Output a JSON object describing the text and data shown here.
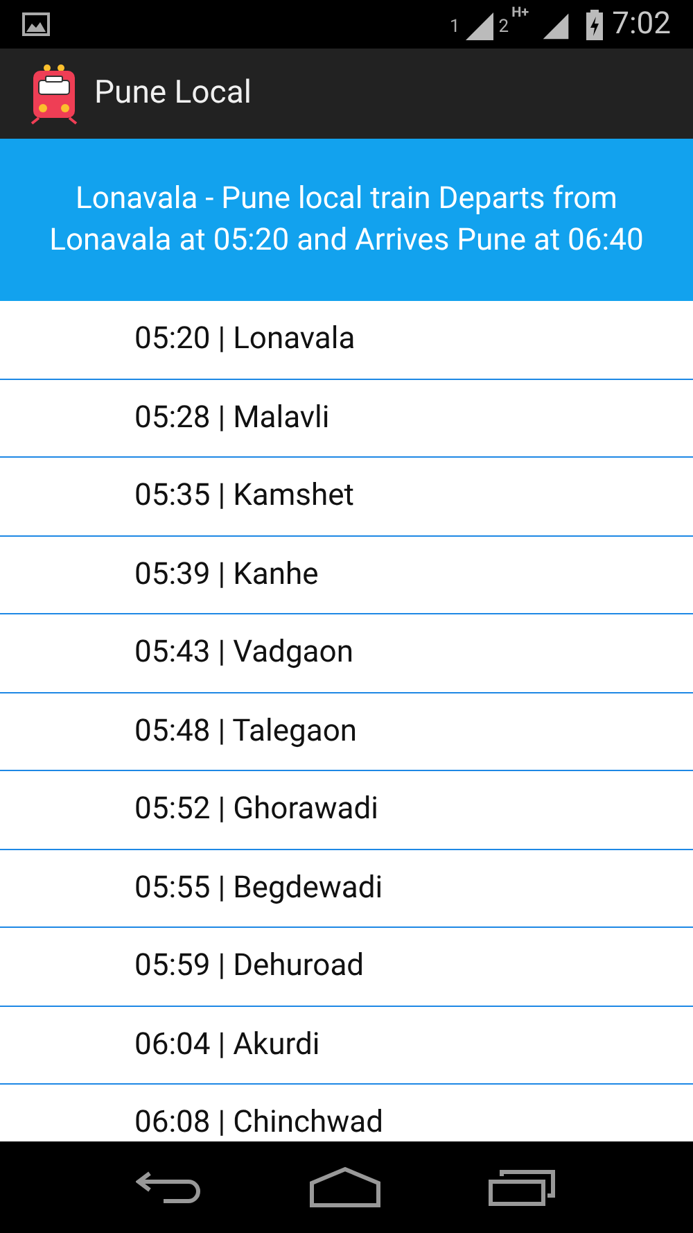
{
  "status_bar": {
    "sim_1": "1",
    "sim_2": "2",
    "network": "H+",
    "time": "7:02"
  },
  "app_bar": {
    "title": "Pune Local"
  },
  "header": {
    "text": "Lonavala - Pune local train Departs from Lonavala at 05:20 and Arrives Pune at 06:40"
  },
  "stops": [
    {
      "text": "05:20 | Lonavala"
    },
    {
      "text": "05:28 | Malavli"
    },
    {
      "text": "05:35 | Kamshet"
    },
    {
      "text": "05:39 | Kanhe"
    },
    {
      "text": "05:43 | Vadgaon"
    },
    {
      "text": "05:48 | Talegaon"
    },
    {
      "text": "05:52 | Ghorawadi"
    },
    {
      "text": "05:55 | Begdewadi"
    },
    {
      "text": "05:59 | Dehuroad"
    },
    {
      "text": "06:04 | Akurdi"
    },
    {
      "text": "06:08 | Chinchwad"
    }
  ]
}
